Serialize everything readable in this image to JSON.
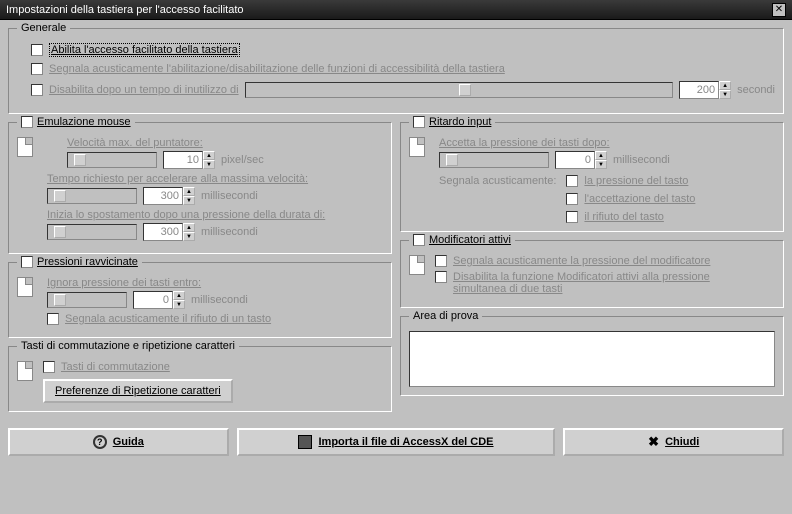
{
  "title": "Impostazioni della tastiera per l'accesso facilitato",
  "generale": {
    "legend": "Generale",
    "enable": "Abilita l'accesso facilitato della tastiera",
    "beep": "Segnala acusticamente l'abilitazione/disabilitazione delle funzioni di accessibilità della tastiera",
    "disable_after": "Disabilita dopo un tempo di inutilizzo di",
    "seconds_label": "secondi",
    "seconds_value": "200"
  },
  "mouse": {
    "legend": "Emulazione mouse",
    "speed_label": "Velocità max. del puntatore:",
    "speed_value": "10",
    "speed_unit": "pixel/sec",
    "accel_label": "Tempo richiesto per accelerare alla massima velocità:",
    "accel_value": "300",
    "accel_unit": "millisecondi",
    "delay_label": "Inizia lo spostamento dopo una pressione della durata di:",
    "delay_value": "300",
    "delay_unit": "millisecondi"
  },
  "ritardo": {
    "legend": "Ritardo input",
    "accept_label": "Accetta la pressione dei tasti dopo:",
    "accept_value": "0",
    "accept_unit": "millisecondi",
    "beep_label": "Segnala acusticamente:",
    "opt1": "la pressione del tasto",
    "opt2": "l'accettazione del tasto",
    "opt3": "il rifiuto del tasto"
  },
  "pressioni": {
    "legend": "Pressioni ravvicinate",
    "ignore_label": "Ignora pressione dei tasti entro:",
    "ignore_value": "0",
    "ignore_unit": "millisecondi",
    "beep_reject": "Segnala acusticamente il rifiuto di un tasto"
  },
  "modificatori": {
    "legend": "Modificatori attivi",
    "beep": "Segnala acusticamente la pressione del modificatore",
    "disable": "Disabilita la funzione Modificatori attivi alla pressione simultanea di due tasti"
  },
  "tasti": {
    "legend": "Tasti di commutazione e ripetizione caratteri",
    "toggle": "Tasti di commutazione",
    "repeat_btn": "Preferenze di Ripetizione caratteri"
  },
  "area": {
    "legend": "Area di prova"
  },
  "buttons": {
    "help": "Guida",
    "import": "Importa il file di AccessX del CDE",
    "close": "Chiudi"
  }
}
